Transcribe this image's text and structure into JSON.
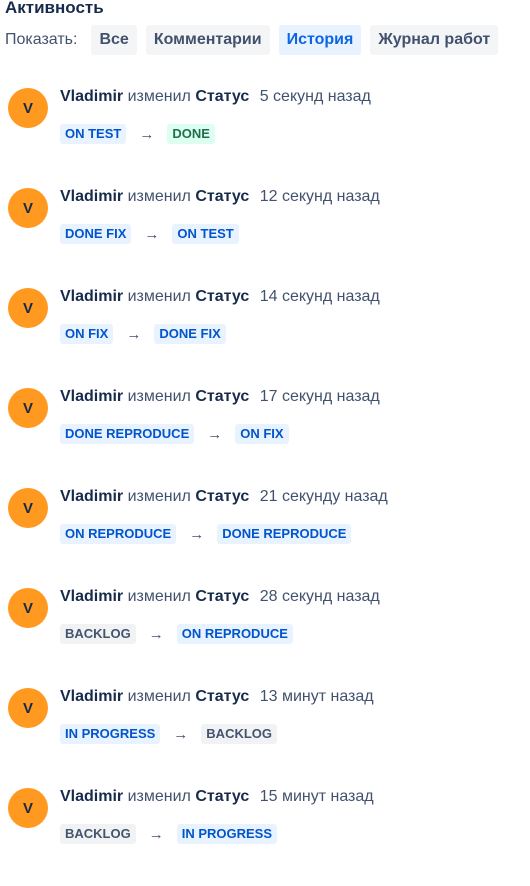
{
  "activity": {
    "title": "Активность",
    "filter_label": "Показать:",
    "filters": [
      {
        "label": "Все",
        "active": false
      },
      {
        "label": "Комментарии",
        "active": false
      },
      {
        "label": "История",
        "active": true
      },
      {
        "label": "Журнал работ",
        "active": false
      }
    ]
  },
  "history": [
    {
      "avatar": "V",
      "author": "Vladimir",
      "action": "изменил",
      "field": "Статус",
      "time": "5 секунд назад",
      "from": {
        "label": "ON TEST",
        "color": "blue"
      },
      "to": {
        "label": "DONE",
        "color": "green"
      }
    },
    {
      "avatar": "V",
      "author": "Vladimir",
      "action": "изменил",
      "field": "Статус",
      "time": "12 секунд назад",
      "from": {
        "label": "DONE FIX",
        "color": "blue"
      },
      "to": {
        "label": "ON TEST",
        "color": "blue"
      }
    },
    {
      "avatar": "V",
      "author": "Vladimir",
      "action": "изменил",
      "field": "Статус",
      "time": "14 секунд назад",
      "from": {
        "label": "ON FIX",
        "color": "blue"
      },
      "to": {
        "label": "DONE FIX",
        "color": "blue"
      }
    },
    {
      "avatar": "V",
      "author": "Vladimir",
      "action": "изменил",
      "field": "Статус",
      "time": "17 секунд назад",
      "from": {
        "label": "DONE REPRODUCE",
        "color": "blue"
      },
      "to": {
        "label": "ON FIX",
        "color": "blue"
      }
    },
    {
      "avatar": "V",
      "author": "Vladimir",
      "action": "изменил",
      "field": "Статус",
      "time": "21 секунду назад",
      "from": {
        "label": "ON REPRODUCE",
        "color": "blue"
      },
      "to": {
        "label": "DONE REPRODUCE",
        "color": "blue"
      }
    },
    {
      "avatar": "V",
      "author": "Vladimir",
      "action": "изменил",
      "field": "Статус",
      "time": "28 секунд назад",
      "from": {
        "label": "BACKLOG",
        "color": "grey"
      },
      "to": {
        "label": "ON REPRODUCE",
        "color": "blue"
      }
    },
    {
      "avatar": "V",
      "author": "Vladimir",
      "action": "изменил",
      "field": "Статус",
      "time": "13 минут назад",
      "from": {
        "label": "IN PROGRESS",
        "color": "blue"
      },
      "to": {
        "label": "BACKLOG",
        "color": "grey"
      }
    },
    {
      "avatar": "V",
      "author": "Vladimir",
      "action": "изменил",
      "field": "Статус",
      "time": "15 минут назад",
      "from": {
        "label": "BACKLOG",
        "color": "grey"
      },
      "to": {
        "label": "IN PROGRESS",
        "color": "blue"
      }
    }
  ],
  "arrow_glyph": "→",
  "colors": {
    "avatar_bg": "#ff991f",
    "active_filter_bg": "#e9f2ff",
    "active_filter_text": "#0c66e4",
    "lozenge_blue_bg": "#e9f2ff",
    "lozenge_green_bg": "#dcfff1",
    "lozenge_grey_bg": "#f1f2f4"
  }
}
